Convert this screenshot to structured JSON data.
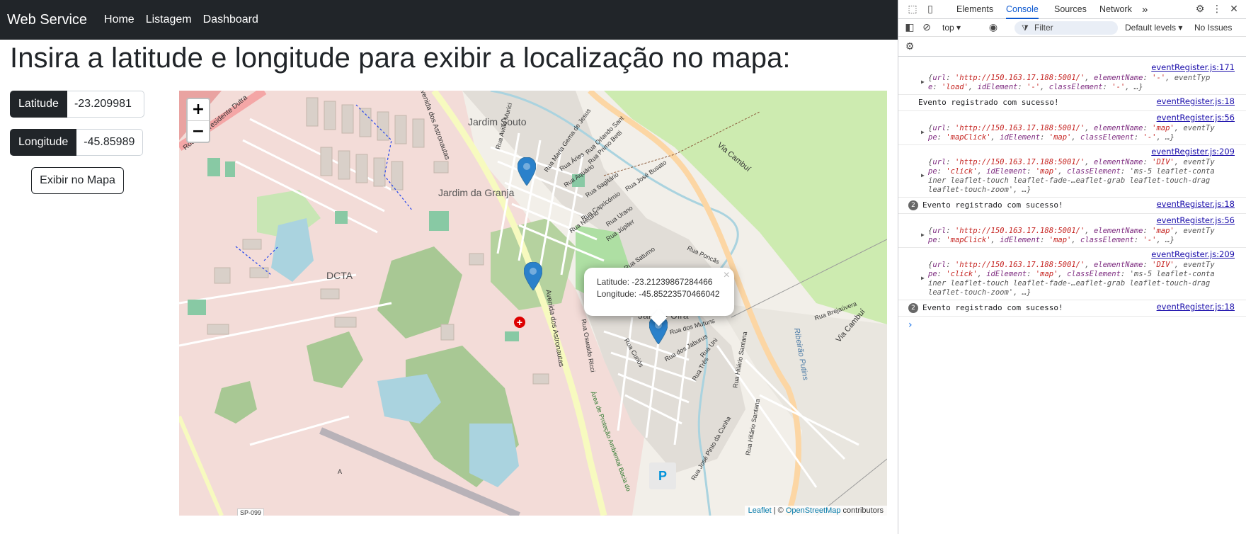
{
  "navbar": {
    "brand": "Web Service",
    "links": [
      "Home",
      "Listagem",
      "Dashboard"
    ]
  },
  "main": {
    "title": "Insira a latitude e longitude para exibir a localização no mapa:",
    "latitude_label": "Latitude",
    "latitude_value": "-23.209981",
    "longitude_label": "Longitude",
    "longitude_value": "-45.85989",
    "show_button": "Exibir no Mapa"
  },
  "map": {
    "zoom_in": "+",
    "zoom_out": "−",
    "popup": {
      "latitude_text": "Latitude: -23.21239867284466",
      "longitude_text": "Longitude: -45.85223570466042",
      "close": "×"
    },
    "labels": {
      "jardim_souto": "Jardim Souto",
      "jardim_granja": "Jardim da Granja",
      "dcta": "DCTA",
      "jardim_uira": "Jardim Uirá",
      "via_cambui": "Via Cambuí",
      "via_cambui_2": "Via Cambuí",
      "ribeirao": "Ribeirão Putins",
      "rodovia": "Rodovia Presidente Dutra",
      "av_astronautas": "Avenida dos Astronautas",
      "av_astronautas_2": "Avenida dos Astronautas",
      "rua_brejauvera": "Rua Brejaúvera",
      "rua_poncas": "Rua Poncãs",
      "rua_jupiter": "Rua Júpiter",
      "rua_urano": "Rua Urano",
      "rua_saturno": "Rua Saturno",
      "rua_netuno": "Rua Netuno",
      "rua_capricornio": "Rua Capricórnio",
      "rua_sagitario": "Rua Sagitário",
      "rua_aquario": "Rua Aquário",
      "rua_aries": "Rua Áries",
      "rua_jose_busato": "Rua José Busato",
      "rua_primo_betti": "Rua Primo Betti",
      "rua_orlando_sant": "Rua Orlando Sant",
      "rua_maria_gema": "Rua Maria Gema de Jesus",
      "rua_aviao": "Rua Avião Murici",
      "rua_mutuns": "Rua dos Mutuns",
      "rua_jaburus": "Rua dos Jaburus",
      "rua_uni": "Rua Uni",
      "rua_tres": "Rua Três",
      "rua_hilario": "Rua Hilário Santana",
      "rua_hilario_2": "Rua Hilário Santana",
      "rua_curions": "Rua Curiós",
      "rua_oswaldo": "Rua Oswaldo Ricci",
      "rua_jose_pinto": "Rua José Pinto da Cunha",
      "area_protecao": "Área de Proteção Ambiental Bacia do",
      "sp099": "SP-099",
      "letter_a": "A",
      "parking": "P",
      "hospital": "+"
    },
    "attribution": {
      "leaflet": "Leaflet",
      "sep": " | © ",
      "osm": "OpenStreetMap",
      "contributors": " contributors"
    }
  },
  "devtools": {
    "tabs": [
      "Elements",
      "Console",
      "Sources",
      "Network"
    ],
    "active_tab": "Console",
    "more_tabs": "»",
    "context": "top ▾",
    "filter_placeholder": "Filter",
    "levels": "Default levels ▾",
    "issues": "No Issues",
    "logs": [
      {
        "src": "eventRegister.js:171",
        "lines": [
          "{url: 'http://150.163.17.188:5001/', elementName: '-', eventTyp",
          "e: 'load', idElement: '-', classElement: '-', …}"
        ]
      },
      {
        "src": "eventRegister.js:18",
        "msg": "Evento registrado com sucesso!"
      },
      {
        "src": "eventRegister.js:56",
        "lines": [
          "{url: 'http://150.163.17.188:5001/', elementName: 'map', eventTy",
          "pe: 'mapClick', idElement: 'map', classElement: '-', …}"
        ]
      },
      {
        "src": "eventRegister.js:209",
        "lines": [
          "{url: 'http://150.163.17.188:5001/', elementName: 'DIV', eventTy",
          "pe: 'click', idElement: 'map', classElement: 'ms-5 leaflet-conta",
          "iner leaflet-touch leaflet-fade-…eaflet-grab leaflet-touch-drag",
          "leaflet-touch-zoom', …}"
        ]
      },
      {
        "src": "eventRegister.js:18",
        "msg": "Evento registrado com sucesso!",
        "count": "2"
      },
      {
        "src": "eventRegister.js:56",
        "lines": [
          "{url: 'http://150.163.17.188:5001/', elementName: 'map', eventTy",
          "pe: 'mapClick', idElement: 'map', classElement: '-', …}"
        ]
      },
      {
        "src": "eventRegister.js:209",
        "lines": [
          "{url: 'http://150.163.17.188:5001/', elementName: 'DIV', eventTy",
          "pe: 'click', idElement: 'map', classElement: 'ms-5 leaflet-conta",
          "iner leaflet-touch leaflet-fade-…eaflet-grab leaflet-touch-drag",
          "leaflet-touch-zoom', …}"
        ]
      },
      {
        "src": "eventRegister.js:18",
        "msg": "Evento registrado com sucesso!",
        "count": "2"
      }
    ],
    "prompt": "›"
  }
}
